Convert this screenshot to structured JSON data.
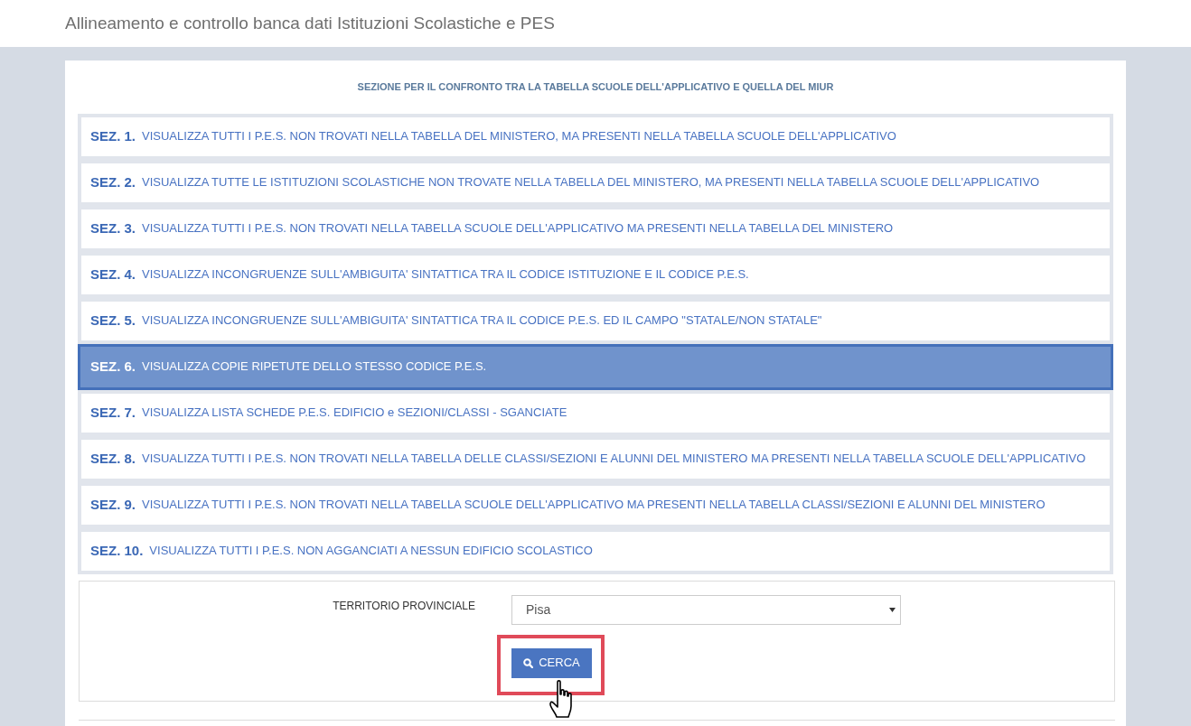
{
  "page_title": "Allineamento e controllo banca dati Istituzioni Scolastiche e PES",
  "panel": {
    "heading": "SEZIONE PER IL CONFRONTO TRA LA TABELLA SCUOLE DELL'APPLICATIVO E QUELLA DEL MIUR",
    "sections": [
      {
        "number": "SEZ. 1.",
        "label": "VISUALIZZA TUTTI I P.E.S. NON TROVATI NELLA TABELLA DEL MINISTERO, MA PRESENTI NELLA TABELLA SCUOLE DELL'APPLICATIVO",
        "selected": false
      },
      {
        "number": "SEZ. 2.",
        "label": "VISUALIZZA TUTTE LE ISTITUZIONI SCOLASTICHE NON TROVATE NELLA TABELLA DEL MINISTERO, MA PRESENTI NELLA TABELLA SCUOLE DELL'APPLICATIVO",
        "selected": false
      },
      {
        "number": "SEZ. 3.",
        "label": "VISUALIZZA TUTTI I P.E.S. NON TROVATI NELLA TABELLA SCUOLE DELL'APPLICATIVO MA PRESENTI NELLA TABELLA DEL MINISTERO",
        "selected": false
      },
      {
        "number": "SEZ. 4.",
        "label": "VISUALIZZA INCONGRUENZE SULL'AMBIGUITA' SINTATTICA TRA IL CODICE ISTITUZIONE E IL CODICE P.E.S.",
        "selected": false
      },
      {
        "number": "SEZ. 5.",
        "label": "VISUALIZZA INCONGRUENZE SULL'AMBIGUITA' SINTATTICA TRA IL CODICE P.E.S. ED IL CAMPO \"STATALE/NON STATALE\"",
        "selected": false
      },
      {
        "number": "SEZ. 6.",
        "label": "VISUALIZZA COPIE RIPETUTE DELLO STESSO CODICE P.E.S.",
        "selected": true
      },
      {
        "number": "SEZ. 7.",
        "label": "VISUALIZZA LISTA SCHEDE P.E.S. EDIFICIO e SEZIONI/CLASSI - SGANCIATE",
        "selected": false
      },
      {
        "number": "SEZ. 8.",
        "label": "VISUALIZZA TUTTI I P.E.S. NON TROVATI NELLA TABELLA DELLE CLASSI/SEZIONI E ALUNNI DEL MINISTERO MA PRESENTI NELLA TABELLA SCUOLE DELL'APPLICATIVO",
        "selected": false
      },
      {
        "number": "SEZ. 9.",
        "label": "VISUALIZZA TUTTI I P.E.S. NON TROVATI NELLA TABELLA SCUOLE DELL'APPLICATIVO MA PRESENTI NELLA TABELLA CLASSI/SEZIONI E ALUNNI DEL MINISTERO",
        "selected": false
      },
      {
        "number": "SEZ. 10.",
        "label": "VISUALIZZA TUTTI I P.E.S. NON AGGANCIATI A NESSUN EDIFICIO SCOLASTICO",
        "selected": false
      }
    ]
  },
  "search_form": {
    "field_label": "TERRITORIO PROVINCIALE",
    "select": {
      "value": "Pisa"
    },
    "button": {
      "label": "CERCA",
      "highlighted": true
    }
  }
}
